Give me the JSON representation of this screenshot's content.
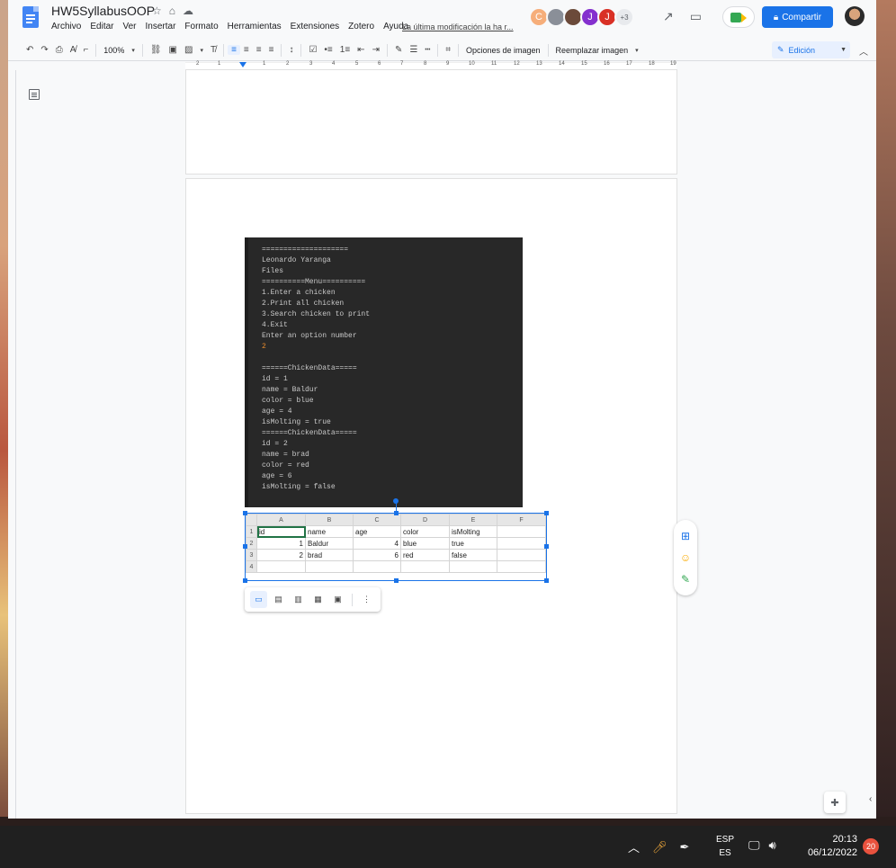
{
  "app": {
    "doc_title": "HW5SyllabusOOP",
    "menu": [
      "Archivo",
      "Editar",
      "Ver",
      "Insertar",
      "Formato",
      "Herramientas",
      "Extensiones",
      "Zotero",
      "Ayuda"
    ],
    "last_edit": "La última modificación la ha r...",
    "collaborators": [
      {
        "letter": "C",
        "color": "#f6ae7a"
      },
      {
        "letter": "",
        "color": "#8a8f98"
      },
      {
        "letter": "",
        "color": "#6b4a3a"
      },
      {
        "letter": "J",
        "color": "#8430ce"
      },
      {
        "letter": "J",
        "color": "#d93025"
      }
    ],
    "more_collaborators": "+3",
    "share_label": "Compartir"
  },
  "toolbar": {
    "zoom": "100%",
    "image_options": "Opciones de imagen",
    "replace_image": "Reemplazar imagen",
    "mode": "Edición"
  },
  "ruler": {
    "marks": [
      "2",
      "1",
      "",
      "1",
      "2",
      "3",
      "4",
      "5",
      "6",
      "7",
      "8",
      "9",
      "10",
      "11",
      "12",
      "13",
      "14",
      "15",
      "16",
      "17",
      "18",
      "19"
    ]
  },
  "console": {
    "lines": [
      "====================",
      "Leonardo Yaranga",
      "Files",
      "==========Menu==========",
      "1.Enter a chicken",
      "2.Print all chicken",
      "3.Search chicken to print",
      "4.Exit",
      "Enter an option number",
      "2",
      "",
      "======ChickenData=====",
      "id = 1",
      "name = Baldur",
      "color = blue",
      "age = 4",
      "isMolting = true",
      "======ChickenData=====",
      "id = 2",
      "name = brad",
      "color = red",
      "age = 6",
      "isMolting = false"
    ]
  },
  "sheet": {
    "columns": [
      "A",
      "B",
      "C",
      "D",
      "E",
      "F"
    ],
    "rows": [
      {
        "n": "1",
        "cells": [
          "id",
          "name",
          "age",
          "color",
          "isMolting",
          ""
        ]
      },
      {
        "n": "2",
        "cells": [
          "1",
          "Baldur",
          "4",
          "blue",
          "true",
          ""
        ]
      },
      {
        "n": "3",
        "cells": [
          "2",
          "brad",
          "6",
          "red",
          "false",
          ""
        ]
      },
      {
        "n": "4",
        "cells": [
          "",
          "",
          "",
          "",
          "",
          ""
        ]
      }
    ]
  },
  "taskbar": {
    "lang_top": "ESP",
    "lang_bottom": "ES",
    "time": "20:13",
    "date": "06/12/2022",
    "notifications": "20"
  }
}
